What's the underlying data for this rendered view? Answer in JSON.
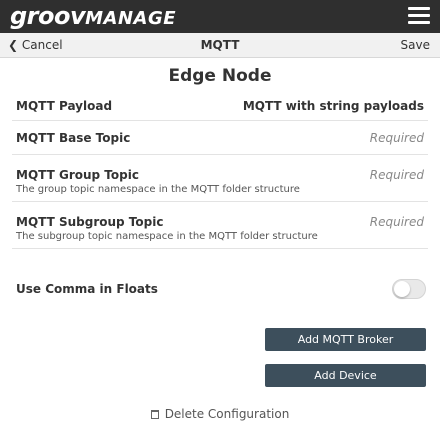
{
  "app": {
    "logo_main": "groov",
    "logo_sub": "MANAGE"
  },
  "navbar": {
    "cancel_label": "Cancel",
    "title": "MQTT",
    "save_label": "Save"
  },
  "page": {
    "heading": "Edge Node"
  },
  "fields": [
    {
      "label": "MQTT Payload",
      "value": "MQTT with string payloads",
      "hint": ""
    },
    {
      "label": "MQTT Base Topic",
      "value": "Required",
      "hint": ""
    },
    {
      "label": "MQTT Group Topic",
      "value": "Required",
      "hint": "The group topic namespace in the MQTT folder structure"
    },
    {
      "label": "MQTT Subgroup Topic",
      "value": "Required",
      "hint": "The subgroup topic namespace in the MQTT folder structure"
    }
  ],
  "use_comma": {
    "label": "Use Comma in Floats",
    "enabled": false
  },
  "buttons": {
    "add_broker": "Add MQTT Broker",
    "add_device": "Add Device"
  },
  "delete": {
    "label": "Delete Configuration"
  },
  "colors": {
    "topbar": "#2f2f2f",
    "button": "#3d4f5c",
    "navbar": "#f1f1f1"
  },
  "icons": {
    "menu": "hamburger-menu-icon",
    "back": "chevron-left-icon",
    "delete": "trash-icon"
  }
}
